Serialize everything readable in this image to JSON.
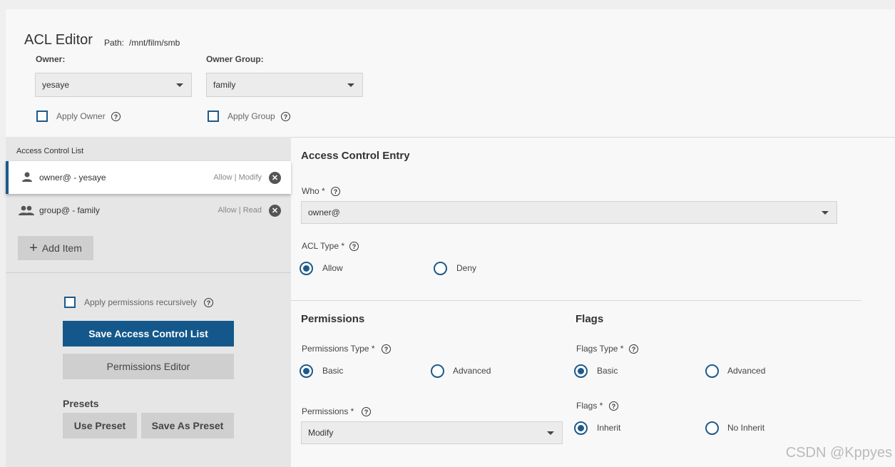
{
  "header": {
    "title": "ACL Editor",
    "path_label": "Path:",
    "path_value": "/mnt/film/smb"
  },
  "owner": {
    "label": "Owner:",
    "value": "yesaye",
    "apply_label": "Apply Owner"
  },
  "owner_group": {
    "label": "Owner Group:",
    "value": "family",
    "apply_label": "Apply Group"
  },
  "acl_list": {
    "heading": "Access Control List",
    "items": [
      {
        "name": "owner@ - yesaye",
        "perm": "Allow | Modify",
        "icon": "person-icon"
      },
      {
        "name": "group@ - family",
        "perm": "Allow | Read",
        "icon": "group-icon"
      }
    ],
    "add_item_label": "Add Item"
  },
  "actions": {
    "recursive_label": "Apply permissions recursively",
    "save_label": "Save Access Control List",
    "permissions_editor_label": "Permissions Editor",
    "presets_heading": "Presets",
    "use_preset_label": "Use Preset",
    "save_preset_label": "Save As Preset"
  },
  "ace": {
    "heading": "Access Control Entry",
    "who_label": "Who *",
    "who_value": "owner@",
    "acl_type_label": "ACL Type *",
    "acl_type_options": [
      "Allow",
      "Deny"
    ],
    "acl_type_selected": "Allow"
  },
  "permissions": {
    "heading": "Permissions",
    "type_label": "Permissions Type *",
    "type_options": [
      "Basic",
      "Advanced"
    ],
    "type_selected": "Basic",
    "perm_label": "Permissions *",
    "perm_value": "Modify"
  },
  "flags": {
    "heading": "Flags",
    "type_label": "Flags Type *",
    "type_options": [
      "Basic",
      "Advanced"
    ],
    "type_selected": "Basic",
    "flags_label": "Flags *",
    "flags_options": [
      "Inherit",
      "No Inherit"
    ],
    "flags_selected": "Inherit"
  },
  "watermark": "CSDN @Kppyes",
  "colors": {
    "accent": "#14588b",
    "background": "#f8f8f8",
    "panel": "#e6e6e6"
  }
}
